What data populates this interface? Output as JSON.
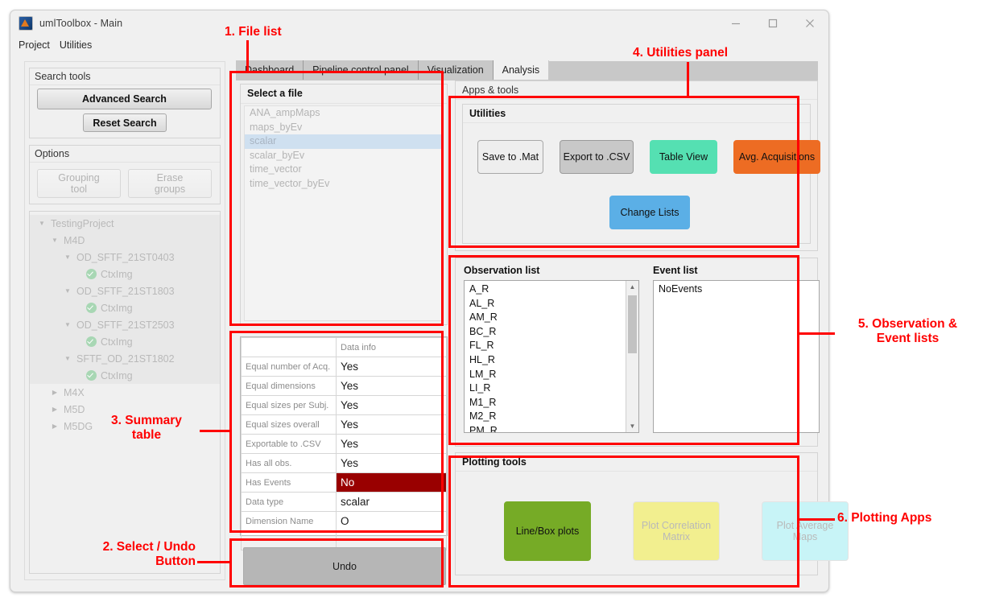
{
  "window": {
    "title": "umlToolbox - Main",
    "controls": {
      "minimize": "minimize-icon",
      "maximize": "maximize-icon",
      "close": "close-icon"
    }
  },
  "menubar": {
    "items": [
      "Project",
      "Utilities"
    ]
  },
  "left_panel": {
    "search_group": {
      "title": "Search tools",
      "advanced_search": "Advanced Search",
      "reset_search": "Reset Search"
    },
    "options_group": {
      "title": "Options",
      "grouping_tool_line1": "Grouping",
      "grouping_tool_line2": "tool",
      "erase_groups_line1": "Erase",
      "erase_groups_line2": "groups"
    },
    "tree": [
      {
        "label": "TestingProject",
        "depth": 0,
        "toggle": "down",
        "check": false,
        "sel": true
      },
      {
        "label": "M4D",
        "depth": 1,
        "toggle": "down",
        "check": false,
        "sel": true
      },
      {
        "label": "OD_SFTF_21ST0403",
        "depth": 2,
        "toggle": "down",
        "check": false,
        "sel": true
      },
      {
        "label": "CtxImg",
        "depth": 3,
        "toggle": "none",
        "check": true,
        "sel": true
      },
      {
        "label": "OD_SFTF_21ST1803",
        "depth": 2,
        "toggle": "down",
        "check": false,
        "sel": true
      },
      {
        "label": "CtxImg",
        "depth": 3,
        "toggle": "none",
        "check": true,
        "sel": true
      },
      {
        "label": "OD_SFTF_21ST2503",
        "depth": 2,
        "toggle": "down",
        "check": false,
        "sel": true
      },
      {
        "label": "CtxImg",
        "depth": 3,
        "toggle": "none",
        "check": true,
        "sel": true
      },
      {
        "label": "SFTF_OD_21ST1802",
        "depth": 2,
        "toggle": "down",
        "check": false,
        "sel": true
      },
      {
        "label": "CtxImg",
        "depth": 3,
        "toggle": "none",
        "check": true,
        "sel": true
      },
      {
        "label": "M4X",
        "depth": 1,
        "toggle": "right",
        "check": false,
        "sel": false
      },
      {
        "label": "M5D",
        "depth": 1,
        "toggle": "right",
        "check": false,
        "sel": false
      },
      {
        "label": "M5DG",
        "depth": 1,
        "toggle": "right",
        "check": false,
        "sel": false
      }
    ]
  },
  "tabs": [
    {
      "label": "Dashboard",
      "active": false
    },
    {
      "label": "Pipeline control panel",
      "active": false
    },
    {
      "label": "Visualization",
      "active": false
    },
    {
      "label": "Analysis",
      "active": true
    }
  ],
  "file_list": {
    "title": "Select a file",
    "items": [
      {
        "label": "ANA_ampMaps",
        "selected": false
      },
      {
        "label": "maps_byEv",
        "selected": false
      },
      {
        "label": "scalar",
        "selected": true
      },
      {
        "label": "scalar_byEv",
        "selected": false
      },
      {
        "label": "time_vector",
        "selected": false
      },
      {
        "label": "time_vector_byEv",
        "selected": false
      }
    ]
  },
  "summary_table": {
    "header": [
      "",
      "Data info"
    ],
    "rows": [
      {
        "key": "Equal number of Acq.",
        "value": "Yes",
        "bad": false
      },
      {
        "key": "Equal dimensions",
        "value": "Yes",
        "bad": false
      },
      {
        "key": "Equal sizes per Subj.",
        "value": "Yes",
        "bad": false
      },
      {
        "key": "Equal sizes overall",
        "value": "Yes",
        "bad": false
      },
      {
        "key": "Exportable to .CSV",
        "value": "Yes",
        "bad": false
      },
      {
        "key": "Has all obs.",
        "value": "Yes",
        "bad": false
      },
      {
        "key": "Has Events",
        "value": "No",
        "bad": true
      },
      {
        "key": "Data type",
        "value": "scalar",
        "bad": false
      },
      {
        "key": "Dimension Name",
        "value": "O",
        "bad": false
      },
      {
        "key": "",
        "value": "",
        "bad": false
      }
    ]
  },
  "undo_button": {
    "label": "Undo"
  },
  "apps_tools": {
    "title": "Apps & tools",
    "utilities_title": "Utilities",
    "buttons": [
      {
        "label": "Save to .Mat",
        "color": "#eeeeee",
        "border": "#a8a8a8",
        "text": "#111111",
        "disabled": false
      },
      {
        "label": "Export to .CSV",
        "color": "#c8c8c8",
        "border": "#9a9a9a",
        "text": "#111111",
        "disabled": false
      },
      {
        "label": "Table View",
        "color": "#55e0b2",
        "border": "#55e0b2",
        "text": "#111111",
        "disabled": false
      },
      {
        "label": "Avg. Acquisitions",
        "color": "#ed6c23",
        "border": "#ed6c23",
        "text": "#111111",
        "disabled": false
      },
      {
        "label": "Change Lists",
        "color": "#5bafe6",
        "border": "#5bafe6",
        "text": "#111111",
        "disabled": false
      }
    ]
  },
  "observation_panel": {
    "observation_title": "Observation list",
    "event_title": "Event list",
    "observations": [
      "A_R",
      "AL_R",
      "AM_R",
      "BC_R",
      "FL_R",
      "HL_R",
      "LM_R",
      "LI_R",
      "M1_R",
      "M2_R",
      "PM_R"
    ],
    "events": [
      "NoEvents"
    ],
    "scroll_up": "scroll-up-icon",
    "scroll_down": "scroll-down-icon"
  },
  "plotting_tools": {
    "title": "Plotting tools",
    "buttons": [
      {
        "label": "Line/Box plots",
        "color": "#76ab26",
        "text": "#111111",
        "disabled": false
      },
      {
        "label": "Plot Correlation Matrix",
        "color": "#f2ef8f",
        "text": "#b9b9b9",
        "disabled": true
      },
      {
        "label": "Plot Average Maps",
        "color": "#c8f4f7",
        "text": "#b9b9b9",
        "disabled": true
      }
    ]
  },
  "annotations": [
    {
      "id": "a1",
      "text": "1. File list"
    },
    {
      "id": "a2",
      "text": "2. Select / Undo\nButton"
    },
    {
      "id": "a3",
      "text": "3. Summary\ntable"
    },
    {
      "id": "a4",
      "text": "4. Utilities panel"
    },
    {
      "id": "a5",
      "text": "5. Observation &\nEvent lists"
    },
    {
      "id": "a6",
      "text": "6. Plotting Apps"
    }
  ]
}
